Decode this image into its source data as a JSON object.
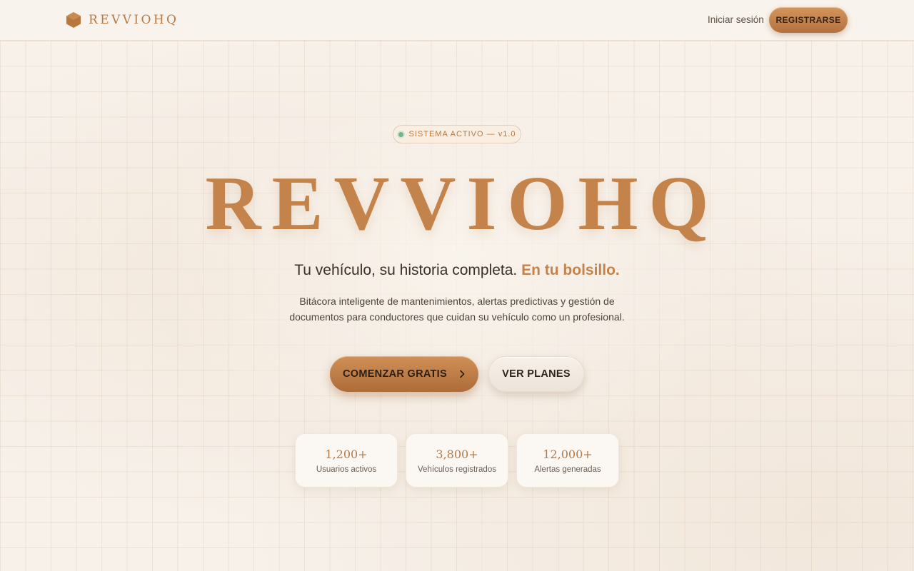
{
  "header": {
    "logo_text": "REVVIOHQ",
    "login_label": "Iniciar sesión",
    "register_label": "REGISTRARSE"
  },
  "hero": {
    "badge_text": "SISTEMA ACTIVO — v1.0",
    "title": "REVVIOHQ",
    "tagline_main": "Tu vehículo, su historia completa.",
    "tagline_accent": "En tu bolsillo.",
    "subtitle": "Bitácora inteligente de mantenimientos, alertas predictivas y gestión de documentos para conductores que cuidan su vehículo como un profesional.",
    "cta_primary": "COMENZAR GRATIS",
    "cta_secondary": "VER PLANES"
  },
  "stats": [
    {
      "value": "1,200+",
      "label": "Usuarios activos"
    },
    {
      "value": "3,800+",
      "label": "Vehículos registrados"
    },
    {
      "value": "12,000+",
      "label": "Alertas generadas"
    }
  ],
  "colors": {
    "accent": "#c4834a",
    "background": "#f7f1ea",
    "status_dot": "#6fb58a"
  },
  "icons": {
    "logo": "hexagon-icon",
    "cta_arrow": "chevron-right-icon"
  }
}
